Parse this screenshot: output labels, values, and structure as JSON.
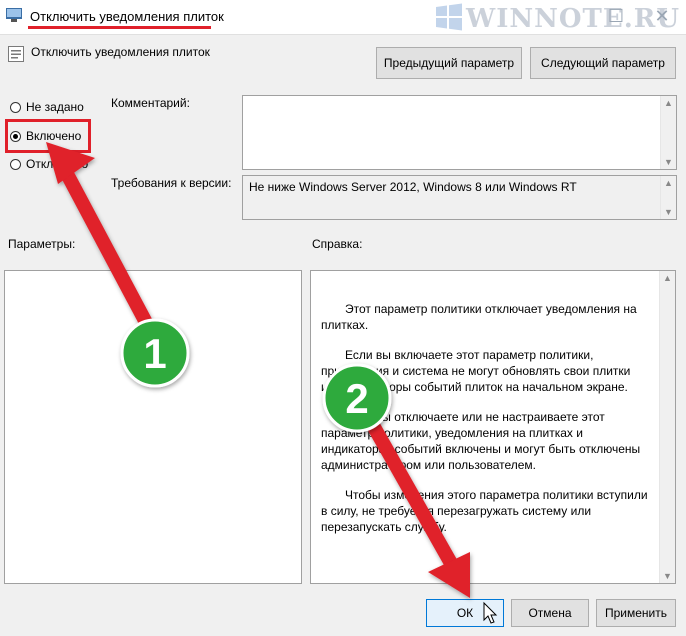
{
  "window": {
    "title": "Отключить уведомления плиток",
    "watermark": "WINNOTE.RU"
  },
  "header": {
    "policy_name": "Отключить уведомления плиток",
    "prev_button": "Предыдущий параметр",
    "next_button": "Следующий параметр"
  },
  "state": {
    "options": [
      {
        "label": "Не задано",
        "checked": false
      },
      {
        "label": "Включено",
        "checked": true
      },
      {
        "label": "Отключено",
        "checked": false
      }
    ]
  },
  "comment": {
    "label": "Комментарий:",
    "value": ""
  },
  "version": {
    "label": "Требования к версии:",
    "value": "Не ниже Windows Server 2012, Windows 8 или Windows RT"
  },
  "params": {
    "label": "Параметры:"
  },
  "help": {
    "label": "Справка:",
    "paragraphs": [
      "Этот параметр политики отключает уведомления на плитках.",
      "Если вы включаете этот параметр политики, приложения и система не могут обновлять свои плитки или индикаторы событий плиток на начальном экране.",
      "Если вы отключаете или не настраиваете этот параметр политики, уведомления на плитках и индикаторах событий включены и могут быть отключены администратором или пользователем.",
      "Чтобы изменения этого параметра политики вступили в силу, не требуется перезагружать систему или перезапускать службу."
    ]
  },
  "footer": {
    "ok": "ОК",
    "cancel": "Отмена",
    "apply": "Применить"
  },
  "annotations": {
    "badge1": "1",
    "badge2": "2",
    "accent_red": "#e0202a",
    "badge_green": "#2eaa3c"
  }
}
